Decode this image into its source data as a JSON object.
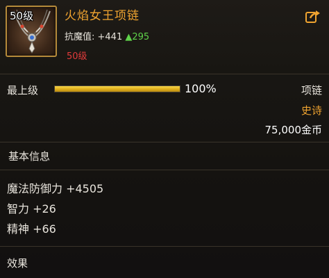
{
  "item": {
    "level_badge": "50级",
    "name": "火焰女王项链",
    "stat_label": "抗魔值: +441",
    "stat_up_arrow": "▲",
    "stat_up_value": "295",
    "required_level": "50级",
    "icon": "necklace-icon"
  },
  "enhance": {
    "label": "最上级",
    "percent_text": "100%",
    "progress": 1.0
  },
  "meta": {
    "type": "项链",
    "rarity": "史诗",
    "price": "75,000金币"
  },
  "basic_info": {
    "title": "基本信息",
    "attributes": [
      "魔法防御力 +4505",
      "智力 +26",
      "精神 +66"
    ]
  },
  "effects": {
    "title": "效果"
  },
  "colors": {
    "name": "#f0a430",
    "rarity": "#f0a430",
    "required_level": "#e23b3b",
    "stat_up": "#5fd24a",
    "bar_fill": "#e3b21e",
    "frame_border": "#b58a3a"
  },
  "icons": {
    "share": "share-icon"
  }
}
